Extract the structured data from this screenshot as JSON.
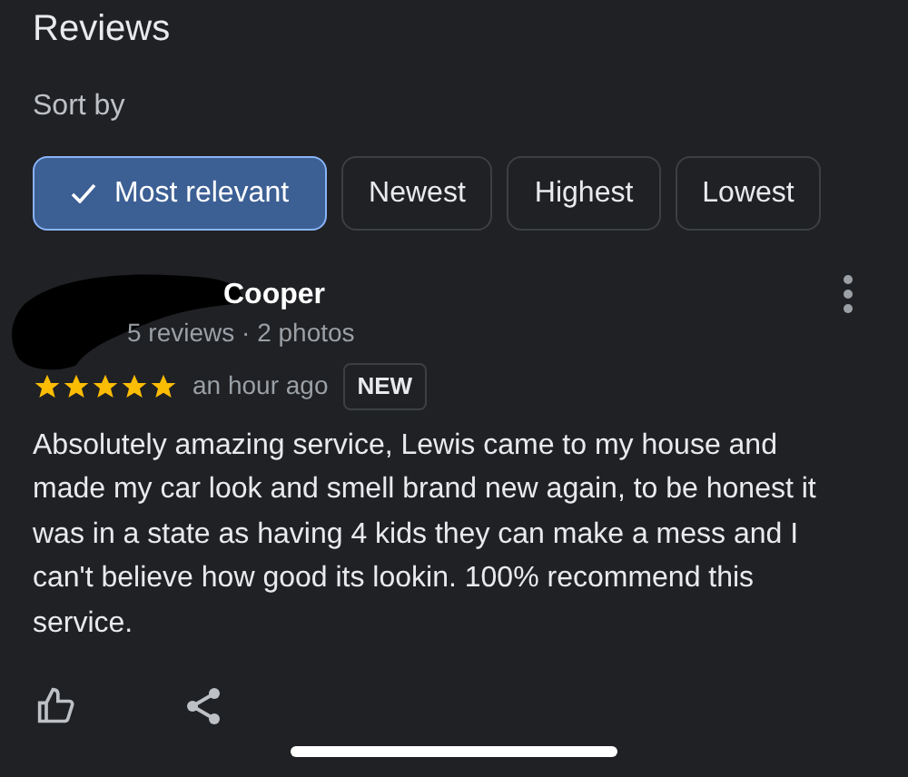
{
  "title": "Reviews",
  "sort": {
    "label": "Sort by",
    "options": [
      {
        "label": "Most relevant",
        "selected": true
      },
      {
        "label": "Newest",
        "selected": false
      },
      {
        "label": "Highest",
        "selected": false
      },
      {
        "label": "Lowest",
        "selected": false
      }
    ]
  },
  "review": {
    "name": "Cooper",
    "meta": "5 reviews · 2 photos",
    "stars": 5,
    "time": "an hour ago",
    "badge": "NEW",
    "text": "Absolutely amazing service, Lewis came to my house and made my car look and smell brand new again, to be honest it was in a state as having 4 kids they can make a mess and I can't believe how good its lookin. 100% recommend this service."
  }
}
